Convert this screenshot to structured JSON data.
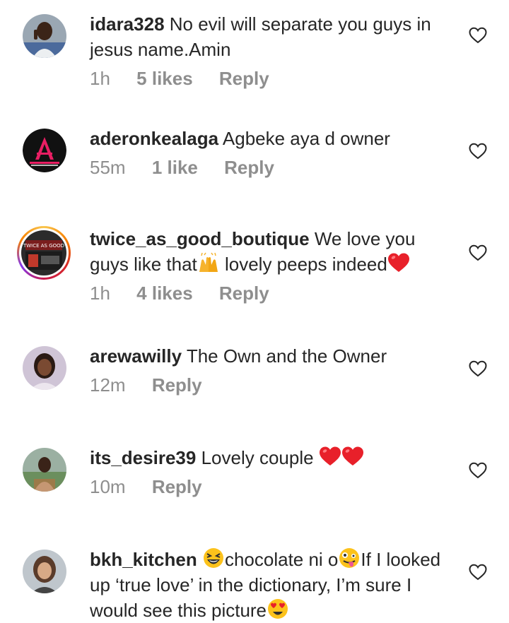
{
  "comments": [
    {
      "username": "idara328",
      "text": "No evil will separate you guys in jesus name.Amin",
      "time": "1h",
      "likes": "5 likes",
      "reply": "Reply"
    },
    {
      "username": "aderonkealaga",
      "text": "Agbeke aya d owner",
      "time": "55m",
      "likes": "1 like",
      "reply": "Reply"
    },
    {
      "username": "twice_as_good_boutique",
      "text_a": "We love you guys like that",
      "text_b": "lovely peeps indeed",
      "time": "1h",
      "likes": "4 likes",
      "reply": "Reply"
    },
    {
      "username": "arewawilly",
      "text": "The Own and the Owner",
      "time": "12m",
      "reply": "Reply"
    },
    {
      "username": "its_desire39",
      "text": "Lovely couple",
      "time": "10m",
      "reply": "Reply"
    },
    {
      "username": "bkh_kitchen",
      "text_a": "chocolate ni o",
      "text_b": "If I looked up ‘true love’ in the dictionary, I’m sure I would see this picture"
    }
  ],
  "icons": {
    "like": "heart-outline-icon",
    "raising_hands": "raising-hands-emoji",
    "red_heart": "red-heart-emoji",
    "laughing": "grinning-squinting-emoji",
    "tongue": "zany-face-emoji",
    "heart_eyes": "heart-eyes-emoji"
  },
  "colors": {
    "text": "#262626",
    "meta": "#8e8e8e",
    "red_heart": "#e8202a"
  }
}
